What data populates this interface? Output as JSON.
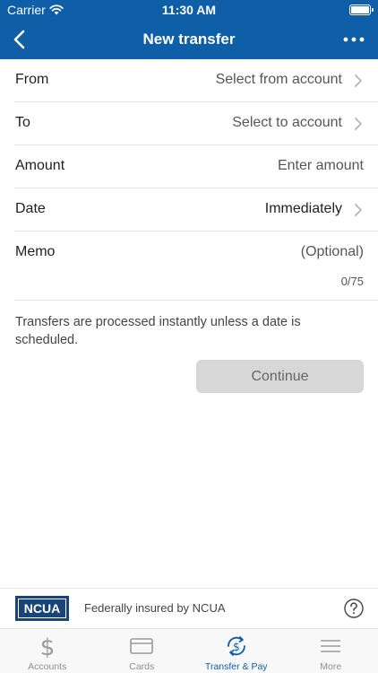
{
  "status_bar": {
    "carrier": "Carrier",
    "time": "11:30 AM"
  },
  "nav": {
    "title": "New transfer",
    "back_icon": "chevron-left-icon",
    "more_icon": "ellipsis-icon"
  },
  "form": {
    "from": {
      "label": "From",
      "value": "Select from account"
    },
    "to": {
      "label": "To",
      "value": "Select to account"
    },
    "amount": {
      "label": "Amount",
      "placeholder": "Enter amount"
    },
    "date": {
      "label": "Date",
      "value": "Immediately"
    },
    "memo": {
      "label": "Memo",
      "placeholder": "(Optional)",
      "counter": "0/75"
    }
  },
  "info_text": "Transfers are processed instantly unless a date is scheduled.",
  "continue_label": "Continue",
  "ncua": {
    "logo_text": "NCUA",
    "text": "Federally insured by NCUA"
  },
  "tabs": [
    {
      "label": "Accounts",
      "icon": "dollar-icon",
      "active": false
    },
    {
      "label": "Cards",
      "icon": "card-icon",
      "active": false
    },
    {
      "label": "Transfer & Pay",
      "icon": "transfer-pay-icon",
      "active": true
    },
    {
      "label": "More",
      "icon": "menu-icon",
      "active": false
    }
  ],
  "colors": {
    "brand": "#0f5ea8",
    "button_disabled": "#d7d7d7"
  }
}
